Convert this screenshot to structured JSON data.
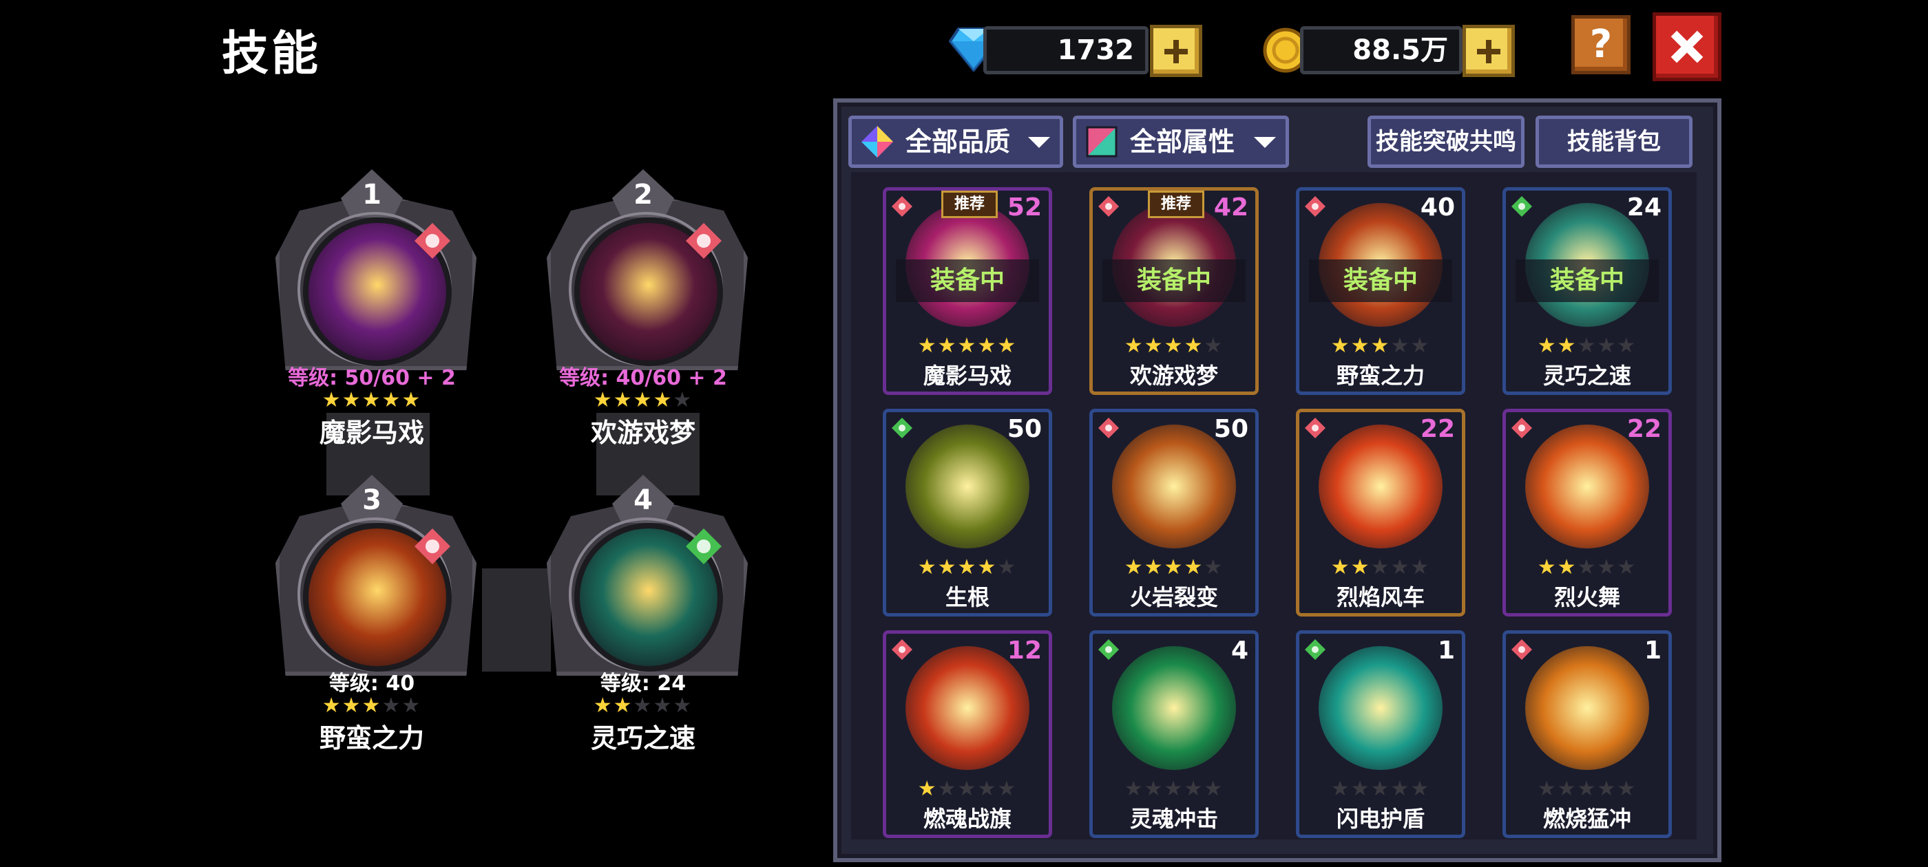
{
  "header": {
    "title": "技能",
    "gems": "1732",
    "coins": "88.5万",
    "help_label": "?"
  },
  "equipped": [
    {
      "slot": "1",
      "level": "等级: 50/60 + 2",
      "stars": 5,
      "name": "魔影马戏",
      "element": "fire",
      "elem_color": "#e85a6a",
      "orb_color": "#6a1e7a"
    },
    {
      "slot": "2",
      "level": "等级: 40/60 + 2",
      "stars": 4,
      "name": "欢游戏梦",
      "element": "fire",
      "elem_color": "#e85a6a",
      "orb_color": "#5a1a3a"
    },
    {
      "slot": "3",
      "level": "等级: 40",
      "stars": 3,
      "name": "野蛮之力",
      "element": "fire",
      "elem_color": "#e85a6a",
      "orb_color": "#a83a12"
    },
    {
      "slot": "4",
      "level": "等级: 24",
      "stars": 2,
      "name": "灵巧之速",
      "element": "nature",
      "elem_color": "#46c050",
      "orb_color": "#1a6a5a"
    }
  ],
  "filters": {
    "quality": "全部品质",
    "attribute": "全部属性",
    "resonance_button": "技能突破共鸣",
    "bag_button": "技能背包"
  },
  "cards": [
    {
      "name": "魔影马戏",
      "count": "52",
      "count_color": "#e86ad8",
      "stars": 5,
      "equipped": true,
      "recommended": true,
      "border": "purple",
      "element": "fire",
      "elem_color": "#e85a6a",
      "art_color": "#a8206a"
    },
    {
      "name": "欢游戏梦",
      "count": "42",
      "count_color": "#e86ad8",
      "stars": 4,
      "equipped": true,
      "recommended": true,
      "border": "orange",
      "element": "fire",
      "elem_color": "#e85a6a",
      "art_color": "#7a1a3a"
    },
    {
      "name": "野蛮之力",
      "count": "40",
      "count_color": "#ffffff",
      "stars": 3,
      "equipped": true,
      "recommended": false,
      "border": "blue",
      "element": "fire",
      "elem_color": "#e85a6a",
      "art_color": "#b8421a"
    },
    {
      "name": "灵巧之速",
      "count": "24",
      "count_color": "#ffffff",
      "stars": 2,
      "equipped": true,
      "recommended": false,
      "border": "blue",
      "element": "nature",
      "elem_color": "#46c050",
      "art_color": "#2a8a78"
    },
    {
      "name": "生根",
      "count": "50",
      "count_color": "#ffffff",
      "stars": 4,
      "equipped": false,
      "recommended": false,
      "border": "blue",
      "element": "nature",
      "elem_color": "#46c050",
      "art_color": "#6a7a1a"
    },
    {
      "name": "火岩裂变",
      "count": "50",
      "count_color": "#ffffff",
      "stars": 4,
      "equipped": false,
      "recommended": false,
      "border": "blue",
      "element": "fire",
      "elem_color": "#e85a6a",
      "art_color": "#b8581a"
    },
    {
      "name": "烈焰风车",
      "count": "22",
      "count_color": "#e86ad8",
      "stars": 2,
      "equipped": false,
      "recommended": false,
      "border": "orange",
      "element": "fire",
      "elem_color": "#e85a6a",
      "art_color": "#d8421a"
    },
    {
      "name": "烈火舞",
      "count": "22",
      "count_color": "#e86ad8",
      "stars": 2,
      "equipped": false,
      "recommended": false,
      "border": "purple",
      "element": "fire",
      "elem_color": "#e85a6a",
      "art_color": "#d8561a"
    },
    {
      "name": "燃魂战旗",
      "count": "12",
      "count_color": "#e86ad8",
      "stars": 1,
      "equipped": false,
      "recommended": false,
      "border": "purple",
      "element": "fire",
      "elem_color": "#e85a6a",
      "art_color": "#c8381a"
    },
    {
      "name": "灵魂冲击",
      "count": "4",
      "count_color": "#ffffff",
      "stars": 0,
      "equipped": false,
      "recommended": false,
      "border": "blue",
      "element": "nature",
      "elem_color": "#46c050",
      "art_color": "#1a8a4a"
    },
    {
      "name": "闪电护盾",
      "count": "1",
      "count_color": "#ffffff",
      "stars": 0,
      "equipped": false,
      "recommended": false,
      "border": "blue",
      "element": "nature",
      "elem_color": "#46c050",
      "art_color": "#1a9a8a"
    },
    {
      "name": "燃烧猛冲",
      "count": "1",
      "count_color": "#ffffff",
      "stars": 0,
      "equipped": false,
      "recommended": false,
      "border": "blue",
      "element": "fire",
      "elem_color": "#e85a6a",
      "art_color": "#d8761a"
    }
  ],
  "labels": {
    "equipped_label": "装备中",
    "recommended_label": "推荐"
  },
  "icons": {
    "gem": "diamond-icon",
    "coin": "gold-coin-icon",
    "quality": "rainbow-gem-icon",
    "attribute": "color-swatch-icon"
  }
}
